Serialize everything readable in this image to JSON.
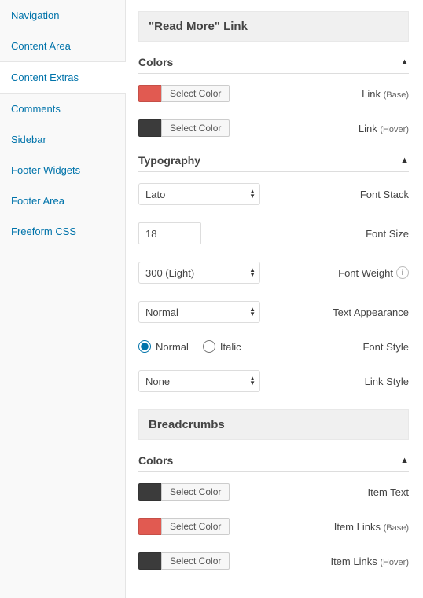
{
  "sidebar": {
    "items": [
      {
        "label": "Navigation"
      },
      {
        "label": "Content Area"
      },
      {
        "label": "Content Extras"
      },
      {
        "label": "Comments"
      },
      {
        "label": "Sidebar"
      },
      {
        "label": "Footer Widgets"
      },
      {
        "label": "Footer Area"
      },
      {
        "label": "Freeform CSS"
      }
    ],
    "active_index": 2
  },
  "sections": {
    "read_more": {
      "title": "\"Read More\" Link",
      "colors": {
        "heading": "Colors",
        "rows": [
          {
            "swatch": "#e15a51",
            "btn": "Select Color",
            "label": "Link",
            "sub": "(Base)"
          },
          {
            "swatch": "#3b3b3b",
            "btn": "Select Color",
            "label": "Link",
            "sub": "(Hover)"
          }
        ]
      },
      "typography": {
        "heading": "Typography",
        "font_stack": {
          "label": "Font Stack",
          "value": "Lato"
        },
        "font_size": {
          "label": "Font Size",
          "value": "18"
        },
        "font_weight": {
          "label": "Font Weight",
          "value": "300 (Light)"
        },
        "text_appearance": {
          "label": "Text Appearance",
          "value": "Normal"
        },
        "font_style": {
          "label": "Font Style",
          "normal": "Normal",
          "italic": "Italic",
          "selected": "normal"
        },
        "link_style": {
          "label": "Link Style",
          "value": "None"
        }
      }
    },
    "breadcrumbs": {
      "title": "Breadcrumbs",
      "colors": {
        "heading": "Colors",
        "rows": [
          {
            "swatch": "#3b3b3b",
            "btn": "Select Color",
            "label": "Item Text",
            "sub": ""
          },
          {
            "swatch": "#e15a51",
            "btn": "Select Color",
            "label": "Item Links",
            "sub": "(Base)"
          },
          {
            "swatch": "#3b3b3b",
            "btn": "Select Color",
            "label": "Item Links",
            "sub": "(Hover)"
          }
        ]
      }
    }
  }
}
